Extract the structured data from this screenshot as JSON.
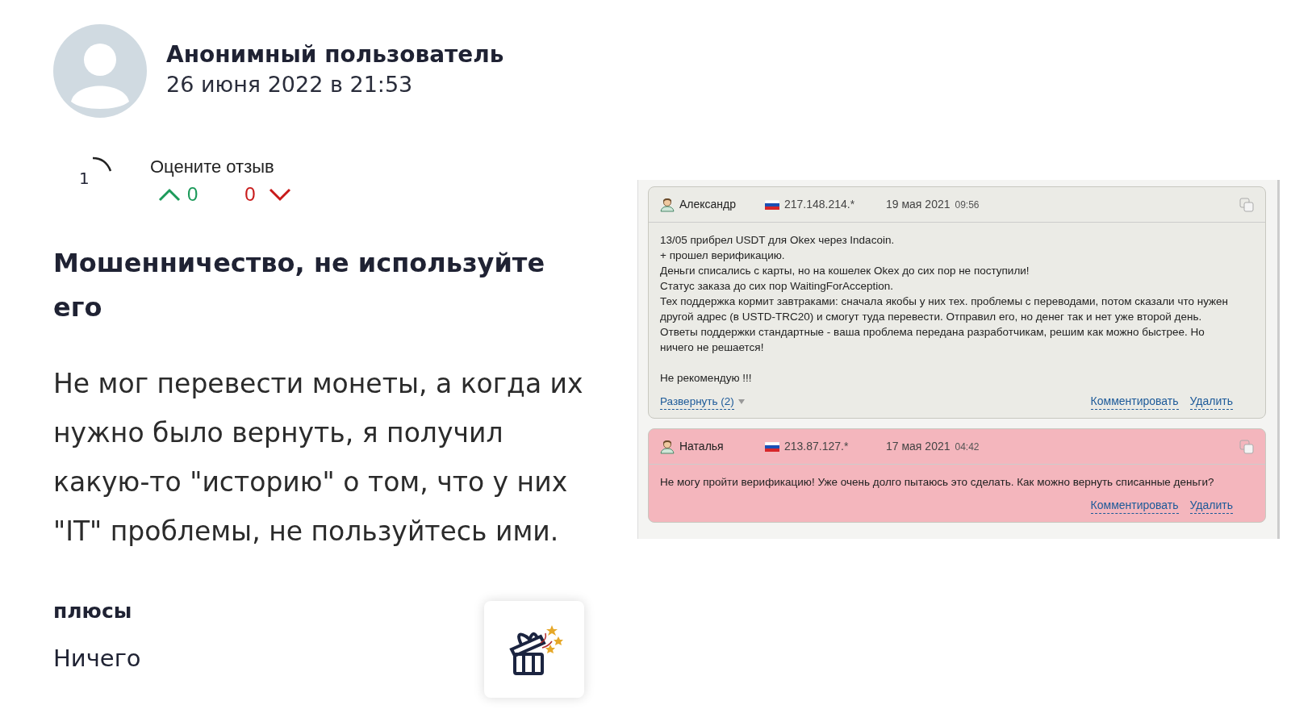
{
  "review": {
    "author": "Анонимный пользователь",
    "date": "26 июня 2022 в 21:53",
    "counter": "1",
    "rate_label": "Оцените отзыв",
    "likes": "0",
    "dislikes": "0",
    "title": "Мошенничество, не используйте его",
    "text": "Не мог перевести монеты, а когда их нужно было вернуть, я получил какую-то \"историю\" о том, что у них \"IT\" проблемы, не пользуйтесь ими.",
    "pros_heading": "плюсы",
    "pros": "Ничего"
  },
  "comments": [
    {
      "name": "Александр",
      "ip": "217.148.214.*",
      "date": "19 мая 2021",
      "time": "09:56",
      "color": "#ebebe6",
      "lines": [
        "13/05 прибрел USDT для Okex через Indacoin.",
        "+ прошел верификацию.",
        "Деньги списались с карты, но на кошелек Okex до сих пор не поступили!",
        "Статус заказа до сих пор WaitingForAcception.",
        "Тех поддержка кормит завтраками: сначала якобы у них тех. проблемы с переводами, потом сказали что нужен другой адрес (в USTD-TRC20) и смогут туда перевести. Отправил его, но денег так и нет уже второй день. Ответы поддержки стандартные - ваша проблема передана разработчикам, решим как можно быстрее. Но ничего не решается!"
      ],
      "closing": "Не рекомендую !!!",
      "expand": "Развернуть (2)",
      "actions": [
        "Комментировать",
        "Удалить"
      ]
    },
    {
      "name": "Наталья",
      "ip": "213.87.127.*",
      "date": "17 мая 2021",
      "time": "04:42",
      "color": "#f4b6bd",
      "lines": [
        "Не могу пройти верификацию! Уже очень долго пытаюсь это сделать. Как можно вернуть списанные деньги?"
      ],
      "actions": [
        "Комментировать",
        "Удалить"
      ]
    }
  ]
}
